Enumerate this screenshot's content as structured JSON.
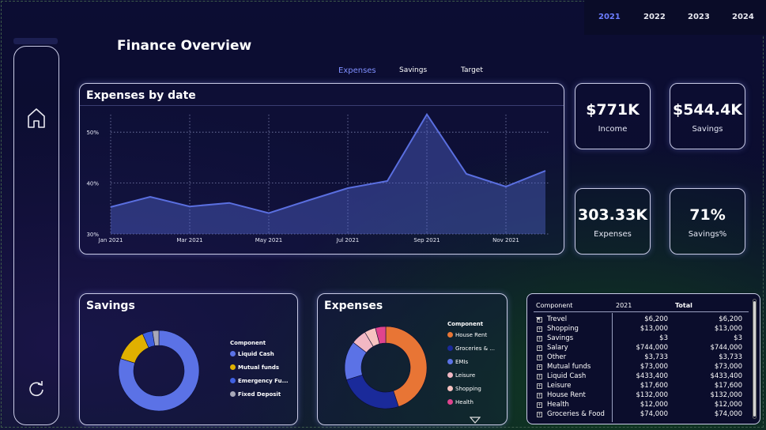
{
  "page": {
    "title": "Finance Overview"
  },
  "years": [
    "2021",
    "2022",
    "2023",
    "2024"
  ],
  "active_year": "2021",
  "tabs": [
    "Expenses",
    "Savings",
    "Target"
  ],
  "active_tab": "Expenses",
  "sidebar": {
    "home_icon": "home-icon",
    "refresh_icon": "refresh-icon"
  },
  "kpis": {
    "income": {
      "value": "$771K",
      "label": "Income"
    },
    "savings": {
      "value": "$544.4K",
      "label": "Savings"
    },
    "expenses": {
      "value": "303.33K",
      "label": "Expenses"
    },
    "savings_pct": {
      "value": "71%",
      "label": "Savings%"
    }
  },
  "expenses_by_date": {
    "title": "Expenses by date",
    "chart_data": {
      "type": "area",
      "x": [
        "Jan 2021",
        "Feb 2021",
        "Mar 2021",
        "Apr 2021",
        "May 2021",
        "Jun 2021",
        "Jul 2021",
        "Aug 2021",
        "Sep 2021",
        "Oct 2021",
        "Nov 2021",
        "Dec 2021"
      ],
      "x_tick_labels": [
        "Jan 2021",
        "Mar 2021",
        "May 2021",
        "Jul 2021",
        "Sep 2021",
        "Nov 2021"
      ],
      "values": [
        35.3,
        37.3,
        35.4,
        36.1,
        34.1,
        36.6,
        39.0,
        40.4,
        53.5,
        41.8,
        39.3,
        42.4
      ],
      "y_ticks": [
        "30%",
        "40%",
        "50%"
      ],
      "ylim": [
        30,
        55
      ],
      "grid": true,
      "color": "#5a6fe0"
    }
  },
  "savings_donut": {
    "title": "Savings",
    "legend_title": "Component",
    "chart_data": {
      "type": "pie",
      "categories": [
        "Liquid Cash",
        "Mutual funds",
        "Emergency Fu...",
        "Fixed Deposit"
      ],
      "values": [
        433400,
        73000,
        22000,
        14000
      ],
      "colors": [
        "#5b72e6",
        "#e0b000",
        "#4060e0",
        "#a8a8b8"
      ]
    }
  },
  "expenses_donut": {
    "title": "Expenses",
    "legend_title": "Component",
    "chart_data": {
      "type": "pie",
      "categories": [
        "House Rent",
        "Groceries & ...",
        "EMIs",
        "Leisure",
        "Shopping",
        "Health"
      ],
      "values": [
        132000,
        74000,
        45000,
        17600,
        13000,
        12000
      ],
      "colors": [
        "#e87535",
        "#1a2a9a",
        "#5b72e6",
        "#f2b8c4",
        "#f7c3c0",
        "#e0448e"
      ]
    }
  },
  "matrix": {
    "headers": {
      "component": "Component",
      "year": "2021",
      "total": "Total"
    },
    "rows": [
      {
        "name": "Trevel",
        "y2021": "$6,200",
        "total": "$6,200"
      },
      {
        "name": "Shopping",
        "y2021": "$13,000",
        "total": "$13,000"
      },
      {
        "name": "Savings",
        "y2021": "$3",
        "total": "$3"
      },
      {
        "name": "Salary",
        "y2021": "$744,000",
        "total": "$744,000"
      },
      {
        "name": "Other",
        "y2021": "$3,733",
        "total": "$3,733"
      },
      {
        "name": "Mutual funds",
        "y2021": "$73,000",
        "total": "$73,000"
      },
      {
        "name": "Liquid Cash",
        "y2021": "$433,400",
        "total": "$433,400"
      },
      {
        "name": "Leisure",
        "y2021": "$17,600",
        "total": "$17,600"
      },
      {
        "name": "House Rent",
        "y2021": "$132,000",
        "total": "$132,000"
      },
      {
        "name": "Health",
        "y2021": "$12,000",
        "total": "$12,000"
      },
      {
        "name": "Groceries & Food",
        "y2021": "$74,000",
        "total": "$74,000"
      }
    ]
  }
}
